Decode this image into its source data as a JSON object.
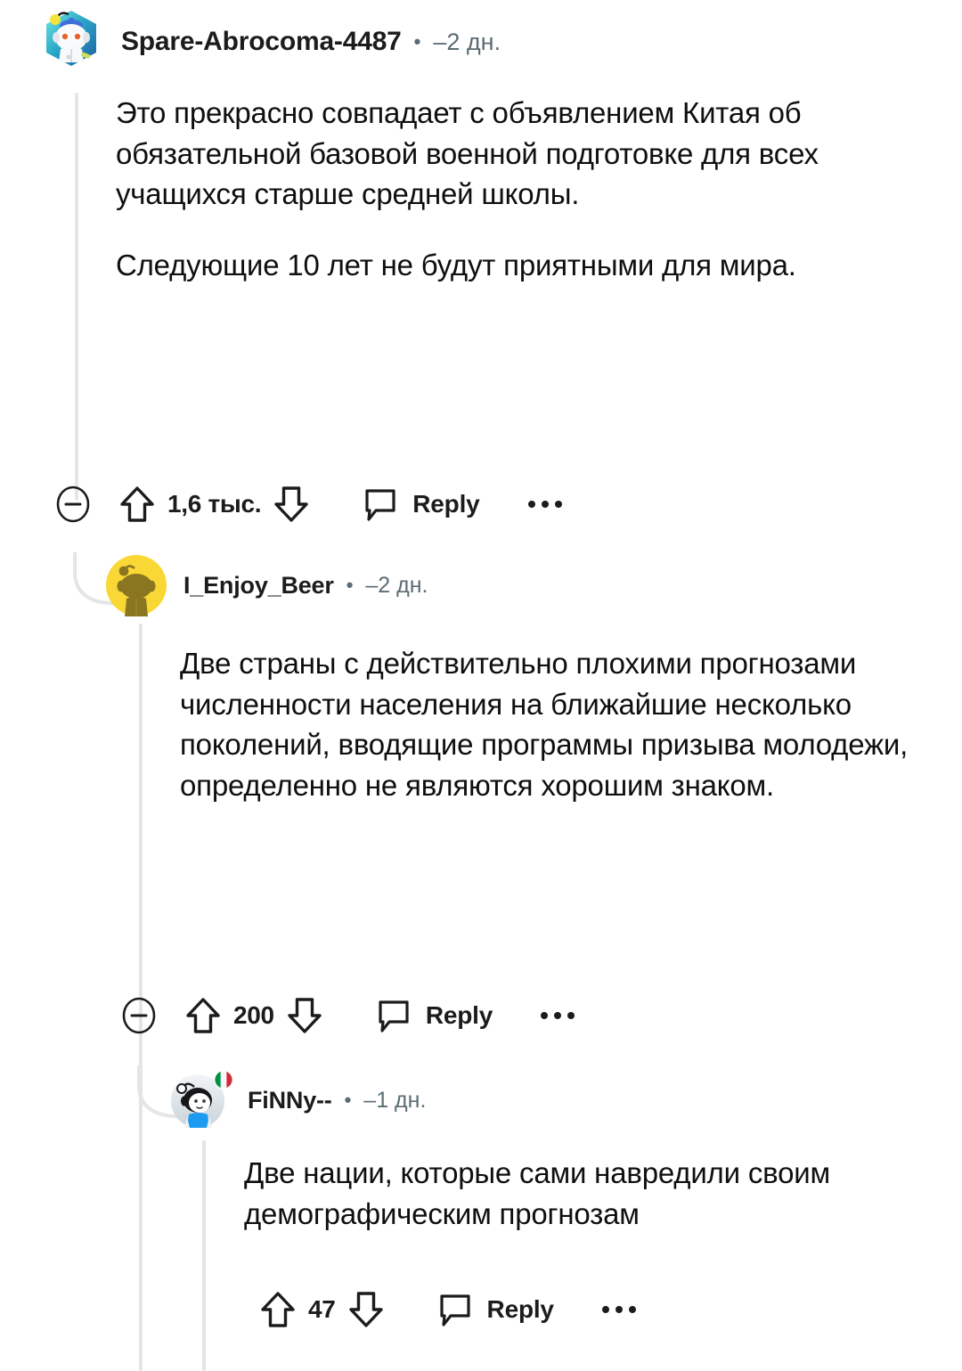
{
  "comments": [
    {
      "id": "comment-1",
      "username": "Spare-Abrocoma-4487",
      "separator": "•",
      "timestamp": "–2 дн.",
      "avatar_icon": "nft-hex-snoo-avatar",
      "paragraphs": [
        "Это прекрасно совпадает с объявлением Китая об обязательной базовой военной подготовке для всех учащихся старше средней школы.",
        "Следующие 10 лет не будут приятными для мира."
      ],
      "score": "1,6 тыс.",
      "reply_label": "Reply",
      "has_collapse": true
    },
    {
      "id": "comment-2",
      "username": "I_Enjoy_Beer",
      "separator": "•",
      "timestamp": "–2 дн.",
      "avatar_icon": "yellow-snoo-avatar",
      "paragraphs": [
        "Две страны с действительно плохими прогнозами численности населения на ближайшие несколько поколений, вводящие программы призыва молодежи, определенно не являются хорошим знаком."
      ],
      "score": "200",
      "reply_label": "Reply",
      "has_collapse": true
    },
    {
      "id": "comment-3",
      "username": "FiNNy--",
      "separator": "•",
      "timestamp": "–1 дн.",
      "avatar_icon": "snoo-avatar-italy-flag",
      "paragraphs": [
        "Две нации, которые сами навредили своим демографическим прогнозам"
      ],
      "score": "47",
      "reply_label": "Reply",
      "has_collapse": false
    }
  ],
  "icons": {
    "collapse": "minus-circle-icon",
    "upvote": "upvote-arrow-icon",
    "downvote": "downvote-arrow-icon",
    "reply": "comment-bubble-icon",
    "more": "overflow-dots-icon"
  },
  "colors": {
    "text": "#0f0f0f",
    "meta": "#5c6c74",
    "thread_line": "#e3e5e6",
    "background": "#ffffff"
  }
}
